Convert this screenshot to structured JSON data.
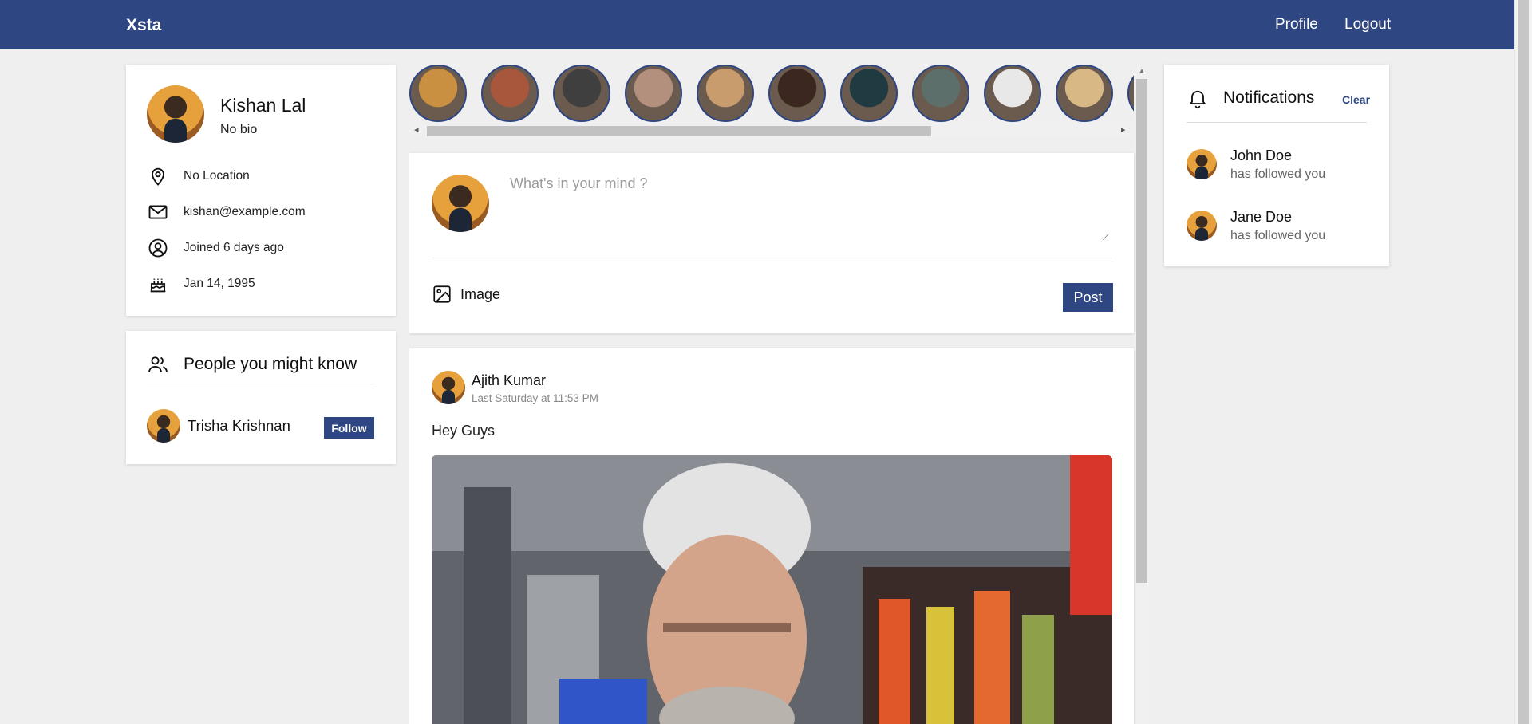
{
  "header": {
    "brand": "Xsta",
    "nav": {
      "profile": "Profile",
      "logout": "Logout"
    }
  },
  "profile": {
    "name": "Kishan Lal",
    "bio": "No bio",
    "location": "No Location",
    "email": "kishan@example.com",
    "joined": "Joined 6 days ago",
    "birthday": "Jan 14, 1995",
    "icons": [
      "location-pin-icon",
      "mail-icon",
      "user-circle-icon",
      "cake-icon"
    ]
  },
  "people": {
    "title": "People you might know",
    "suggestions": [
      {
        "name": "Trisha Krishnan",
        "action": "Follow"
      }
    ]
  },
  "stories": {
    "colors": [
      "#c89040",
      "#a8573c",
      "#3f3f3f",
      "#b38f7d",
      "#c99c6d",
      "#3b2620",
      "#1f3a40",
      "#5d6f6a",
      "#e8e8e8",
      "#d8b986",
      "#d8a23c"
    ]
  },
  "composer": {
    "placeholder": "What's in your mind ?",
    "image_label": "Image",
    "post_label": "Post"
  },
  "feed": [
    {
      "author": "Ajith Kumar",
      "time": "Last Saturday at 11:53 PM",
      "text": "Hey Guys"
    }
  ],
  "notifications": {
    "title": "Notifications",
    "clear": "Clear",
    "items": [
      {
        "name": "John Doe",
        "text": "has followed you"
      },
      {
        "name": "Jane Doe",
        "text": "has followed you"
      }
    ]
  },
  "theme": {
    "primary": "#2e4682",
    "background": "#efefef"
  }
}
